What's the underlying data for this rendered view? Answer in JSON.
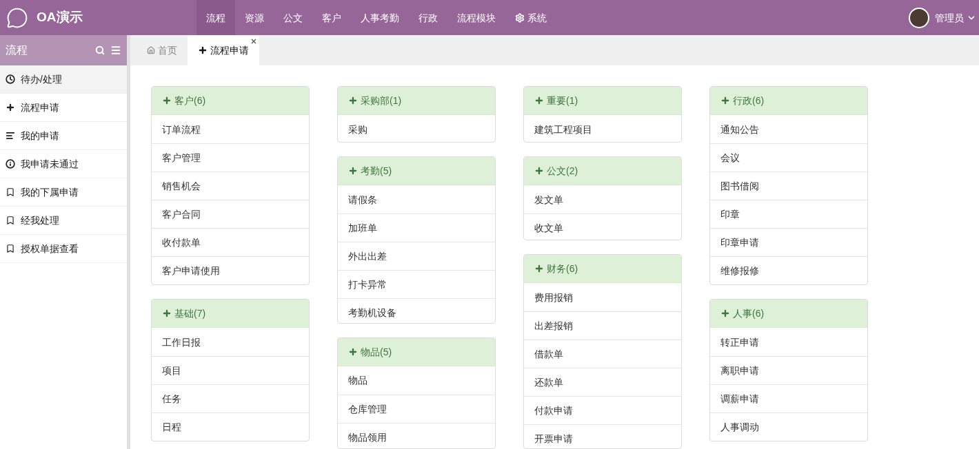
{
  "app": {
    "title": "OA演示"
  },
  "nav": [
    {
      "label": "流程",
      "selected": true
    },
    {
      "label": "资源",
      "selected": false
    },
    {
      "label": "公文",
      "selected": false
    },
    {
      "label": "客户",
      "selected": false
    },
    {
      "label": "人事考勤",
      "selected": false
    },
    {
      "label": "行政",
      "selected": false
    },
    {
      "label": "流程模块",
      "selected": false
    },
    {
      "label": "系统",
      "selected": false,
      "kind": "gear"
    }
  ],
  "user": {
    "name": "管理员"
  },
  "sidebar": {
    "title": "流程",
    "items": [
      {
        "label": "待办/处理",
        "kind": "clock",
        "selected": true
      },
      {
        "label": "流程申请",
        "kind": "plus",
        "selected": false
      },
      {
        "label": "我的申请",
        "kind": "list",
        "selected": false
      },
      {
        "label": "我申请未通过",
        "kind": "info",
        "selected": false
      },
      {
        "label": "我的下属申请",
        "kind": "bookmark",
        "selected": false
      },
      {
        "label": "经我处理",
        "kind": "bookmark",
        "selected": false
      },
      {
        "label": "授权单据查看",
        "kind": "bookmark",
        "selected": false
      }
    ]
  },
  "tabs": [
    {
      "label": "首页",
      "kind": "home",
      "selected": false,
      "closable": false
    },
    {
      "label": "流程申请",
      "kind": "plus",
      "selected": true,
      "closable": true
    }
  ],
  "columns": [
    [
      {
        "title": "客户(6)",
        "items": [
          "订单流程",
          "客户管理",
          "销售机会",
          "客户合同",
          "收付款单",
          "客户申请使用"
        ]
      },
      {
        "title": "基础(7)",
        "items": [
          "工作日报",
          "项目",
          "任务",
          "日程"
        ]
      }
    ],
    [
      {
        "title": "采购部(1)",
        "items": [
          "采购"
        ]
      },
      {
        "title": "考勤(5)",
        "items": [
          "请假条",
          "加班单",
          "外出出差",
          "打卡异常",
          "考勤机设备"
        ]
      },
      {
        "title": "物品(5)",
        "items": [
          "物品",
          "仓库管理",
          "物品领用"
        ]
      }
    ],
    [
      {
        "title": "重要(1)",
        "items": [
          "建筑工程项目"
        ]
      },
      {
        "title": "公文(2)",
        "items": [
          "发文单",
          "收文单"
        ]
      },
      {
        "title": "财务(6)",
        "items": [
          "费用报销",
          "出差报销",
          "借款单",
          "还款单",
          "付款申请",
          "开票申请"
        ]
      }
    ],
    [
      {
        "title": "行政(6)",
        "items": [
          "通知公告",
          "会议",
          "图书借阅",
          "印章",
          "印章申请",
          "维修报修"
        ]
      },
      {
        "title": "人事(6)",
        "items": [
          "转正申请",
          "离职申请",
          "调薪申请",
          "人事调动"
        ]
      }
    ]
  ]
}
